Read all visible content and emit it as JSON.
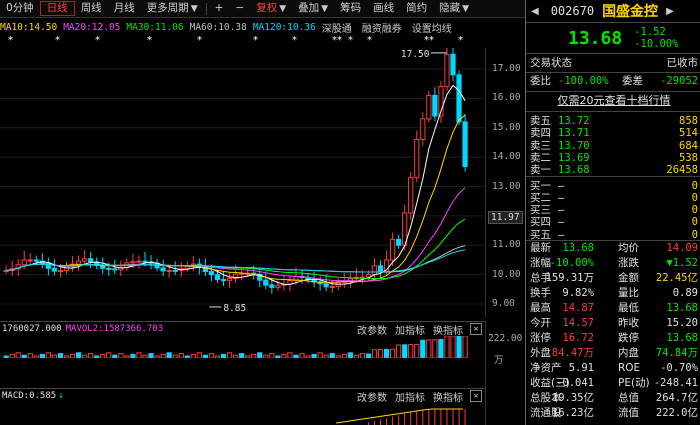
{
  "toolbar": {
    "items": [
      "0分钟",
      "日线",
      "周线",
      "月线",
      "更多周期",
      "+",
      "−",
      "复权",
      "叠加",
      "筹码",
      "画线",
      "简约",
      "隐藏"
    ],
    "active": "日线"
  },
  "ma_legend": {
    "ma10": "MA10:14.50",
    "ma20": "MA20:12.05",
    "ma30": "MA30:11.06",
    "ma60": "MA60:10.38",
    "ma120": "MA120:10.36",
    "btn1": "深股通",
    "btn2": "融资融券",
    "btn3": "设置均线"
  },
  "price_axis": {
    "ticks": [
      "17.00",
      "16.00",
      "15.00",
      "14.00",
      "13.00",
      "12.00",
      "11.00",
      "10.00",
      "9.00"
    ],
    "current": "11.97"
  },
  "annotations": {
    "high": "17.50",
    "low": "8.85"
  },
  "volume_panel": {
    "title": "1760027.000",
    "mavol": "MAVOL2:1587366.703",
    "btn_params": "改参数",
    "btn_index": "加指标",
    "btn_switch": "换指标",
    "axis_top": "222.00",
    "axis_unit": "万"
  },
  "macd_panel": {
    "title": "MACD:0.585",
    "btn_params": "改参数",
    "btn_index": "加指标",
    "btn_switch": "换指标"
  },
  "colors": {
    "up": "#ff3b3b",
    "down": "#00d8ff",
    "ma5": "#ffffff",
    "ma10": "#ffd700",
    "ma20": "#ff40ff",
    "ma30": "#00ff00",
    "ma60": "#c0c0c0",
    "ma120": "#00d8ff"
  },
  "quote": {
    "code": "002670",
    "name": "国盛金控",
    "price": "13.68",
    "change": "-1.52",
    "change_pct": "-10.00%",
    "status_label": "交易状态",
    "status": "已收市",
    "weibi_label": "委比",
    "weibi": "-100.00%",
    "weicha_label": "委差",
    "weicha": "-29052",
    "promo": "仅需20元查看十档行情",
    "asks": [
      {
        "label": "卖五",
        "price": "13.72",
        "vol": "858"
      },
      {
        "label": "卖四",
        "price": "13.71",
        "vol": "514"
      },
      {
        "label": "卖三",
        "price": "13.70",
        "vol": "684"
      },
      {
        "label": "卖二",
        "price": "13.69",
        "vol": "538"
      },
      {
        "label": "卖一",
        "price": "13.68",
        "vol": "26458"
      }
    ],
    "bids": [
      {
        "label": "买一",
        "price": "—",
        "vol": "0"
      },
      {
        "label": "买二",
        "price": "—",
        "vol": "0"
      },
      {
        "label": "买三",
        "price": "—",
        "vol": "0"
      },
      {
        "label": "买四",
        "price": "—",
        "vol": "0"
      },
      {
        "label": "买五",
        "price": "—",
        "vol": "0"
      }
    ],
    "stats": [
      {
        "l1": "最新",
        "v1": "13.68",
        "c1": "g",
        "l2": "均价",
        "v2": "14.09",
        "c2": "r"
      },
      {
        "l1": "涨幅",
        "v1": "-10.00%",
        "c1": "g",
        "l2": "涨跌",
        "v2": "▼1.52",
        "c2": "g"
      },
      {
        "l1": "总手",
        "v1": "159.31万",
        "c1": "w",
        "l2": "金额",
        "v2": "22.45亿",
        "c2": "y"
      },
      {
        "l1": "换手",
        "v1": "9.82%",
        "c1": "w",
        "l2": "量比",
        "v2": "0.89",
        "c2": "w"
      },
      {
        "l1": "最高",
        "v1": "14.87",
        "c1": "r",
        "l2": "最低",
        "v2": "13.68",
        "c2": "g"
      },
      {
        "l1": "今开",
        "v1": "14.57",
        "c1": "r",
        "l2": "昨收",
        "v2": "15.20",
        "c2": "w"
      },
      {
        "l1": "涨停",
        "v1": "16.72",
        "c1": "r",
        "l2": "跌停",
        "v2": "13.68",
        "c2": "g"
      },
      {
        "l1": "外盘",
        "v1": "84.47万",
        "c1": "r",
        "l2": "内盘",
        "v2": "74.84万",
        "c2": "g"
      },
      {
        "l1": "净资产",
        "v1": "5.91",
        "c1": "w",
        "l2": "ROE",
        "v2": "-0.70%",
        "c2": "w"
      },
      {
        "l1": "收益(三)",
        "v1": "-0.041",
        "c1": "w",
        "l2": "PE(动)",
        "v2": "-248.41",
        "c2": "w"
      },
      {
        "l1": "总股本",
        "v1": "19.35亿",
        "c1": "w",
        "l2": "总值",
        "v2": "264.7亿",
        "c2": "w"
      },
      {
        "l1": "流通股",
        "v1": "16.23亿",
        "c1": "w",
        "l2": "流值",
        "v2": "222.0亿",
        "c2": "w"
      }
    ]
  }
}
